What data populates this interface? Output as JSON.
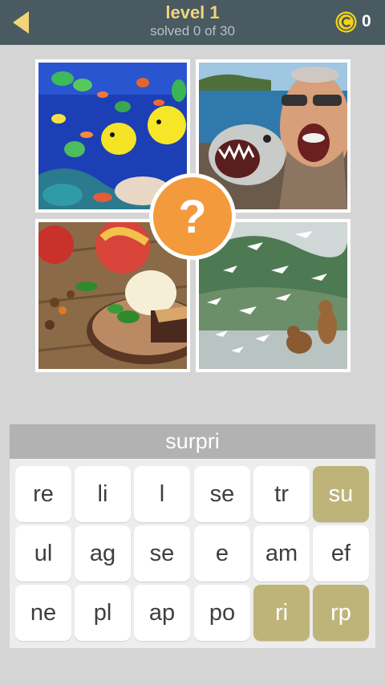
{
  "header": {
    "level_title": "level 1",
    "progress_text": "solved 0 of 30",
    "coin_count": "0",
    "back_icon": "back-arrow-icon",
    "coin_icon": "coin-icon"
  },
  "photos": [
    {
      "subject": "tropical reef fish"
    },
    {
      "subject": "man shouting next to fish"
    },
    {
      "subject": "apple dessert with ice cream"
    },
    {
      "subject": "bears and seagulls"
    }
  ],
  "hint": {
    "symbol": "?"
  },
  "answer": {
    "text": "surpri"
  },
  "tiles": [
    {
      "label": "re",
      "used": false
    },
    {
      "label": "li",
      "used": false
    },
    {
      "label": "l",
      "used": false
    },
    {
      "label": "se",
      "used": false
    },
    {
      "label": "tr",
      "used": false
    },
    {
      "label": "su",
      "used": true
    },
    {
      "label": "ul",
      "used": false
    },
    {
      "label": "ag",
      "used": false
    },
    {
      "label": "se",
      "used": false
    },
    {
      "label": "e",
      "used": false
    },
    {
      "label": "am",
      "used": false
    },
    {
      "label": "ef",
      "used": false
    },
    {
      "label": "ne",
      "used": false
    },
    {
      "label": "pl",
      "used": false
    },
    {
      "label": "ap",
      "used": false
    },
    {
      "label": "po",
      "used": false
    },
    {
      "label": "ri",
      "used": true
    },
    {
      "label": "rp",
      "used": true
    }
  ],
  "colors": {
    "header_bg": "#4a5a61",
    "title": "#f3d47a",
    "coin": "#f5d316",
    "hint": "#f29a3c",
    "used_tile": "#beb47a"
  }
}
